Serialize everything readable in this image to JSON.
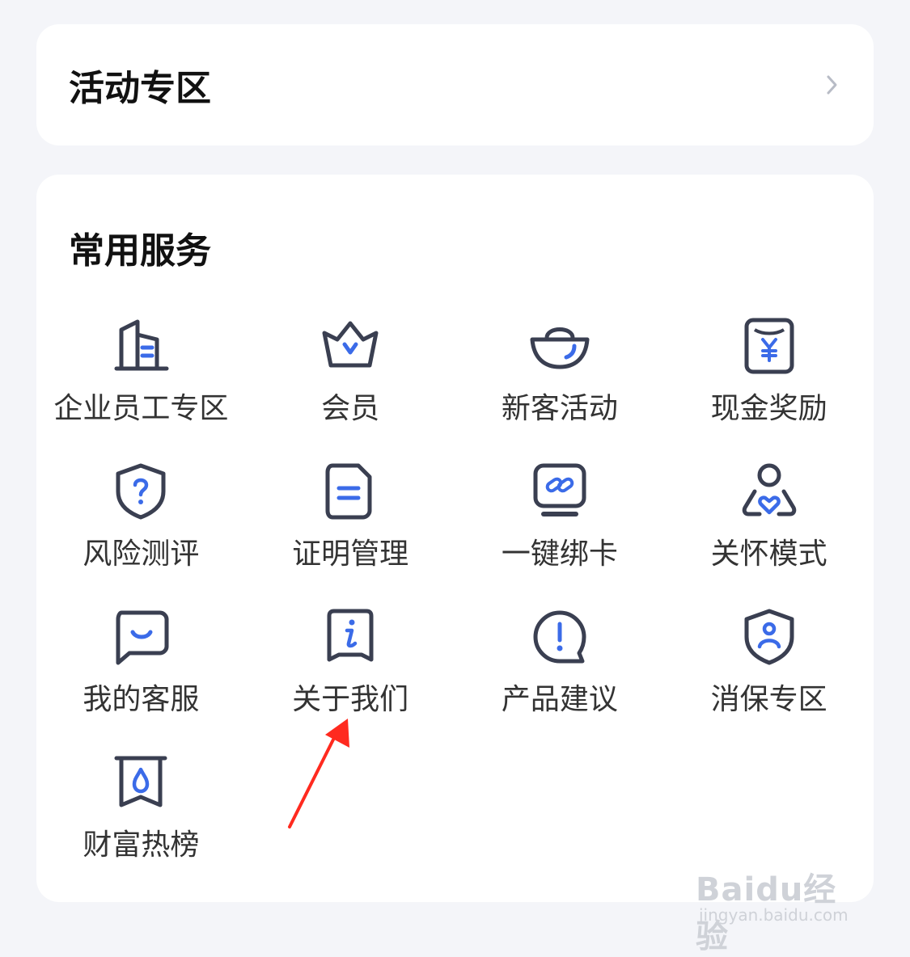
{
  "activity": {
    "title": "活动专区"
  },
  "services": {
    "title": "常用服务",
    "items": [
      {
        "label": "企业员工专区",
        "icon": "building-icon"
      },
      {
        "label": "会员",
        "icon": "crown-icon"
      },
      {
        "label": "新客活动",
        "icon": "gold-ingot-icon"
      },
      {
        "label": "现金奖励",
        "icon": "yen-card-icon"
      },
      {
        "label": "风险测评",
        "icon": "shield-question-icon"
      },
      {
        "label": "证明管理",
        "icon": "document-icon"
      },
      {
        "label": "一键绑卡",
        "icon": "link-card-icon"
      },
      {
        "label": "关怀模式",
        "icon": "care-heart-icon"
      },
      {
        "label": "我的客服",
        "icon": "chat-smile-icon"
      },
      {
        "label": "关于我们",
        "icon": "info-icon"
      },
      {
        "label": "产品建议",
        "icon": "exclamation-bubble-icon"
      },
      {
        "label": "消保专区",
        "icon": "shield-user-icon"
      },
      {
        "label": "财富热榜",
        "icon": "fire-banner-icon"
      }
    ]
  },
  "watermark": {
    "brand": "Baidu经验",
    "url": "jingyan.baidu.com"
  },
  "colors": {
    "accent": "#3b6be8",
    "stroke": "#3a3f51",
    "annotation": "#ff2a1f"
  }
}
